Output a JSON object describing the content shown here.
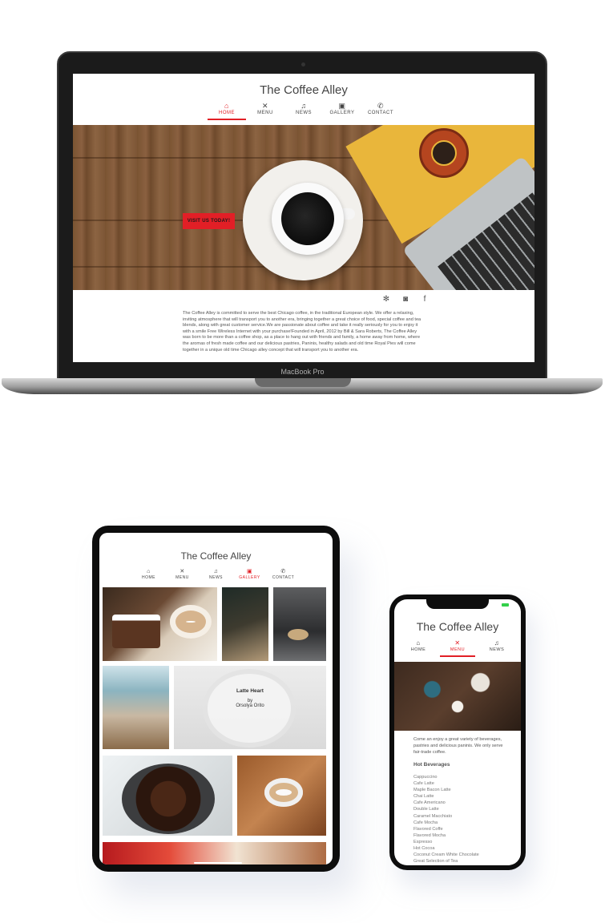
{
  "site": {
    "title": "The Coffee Alley"
  },
  "laptop": {
    "brand": "MacBook Pro",
    "nav": [
      {
        "label": "HOME",
        "icon": "home-icon",
        "active": true
      },
      {
        "label": "MENU",
        "icon": "utensils-icon",
        "active": false
      },
      {
        "label": "NEWS",
        "icon": "bell-icon",
        "active": false
      },
      {
        "label": "GALLERY",
        "icon": "gallery-icon",
        "active": false
      },
      {
        "label": "CONTACT",
        "icon": "phone-icon",
        "active": false
      }
    ],
    "cta": "VISIT US TODAY!",
    "social": [
      "yelp-icon",
      "instagram-icon",
      "facebook-icon"
    ],
    "about": "The Coffee Alley is committed to serve the best Chicago coffee, in the traditional European style.  We offer a relaxing, inviting atmosphere that will transport you to another era, bringing together a great choice of food, special coffee and tea blends, along with great customer service.We are passionate about coffee  and take it really seriously for you to enjoy it  with a smile Free Wireless Internet with your purchase!Founded in April, 2012 by Bill & Sara Roberts, The Coffee Alley was born to be more than a coffee shop,  as a place to hang out with friends and  family,  a home away from home,  where the aromas of fresh made coffee and our delicious pastries, Paninis,  healthy salads and old time Royal Pies will come together in a unique old time Chicago alley concept that will transport you to another era."
  },
  "tablet": {
    "nav": [
      {
        "label": "HOME",
        "icon": "home-icon",
        "active": false
      },
      {
        "label": "MENU",
        "icon": "utensils-icon",
        "active": false
      },
      {
        "label": "NEWS",
        "icon": "bell-icon",
        "active": false
      },
      {
        "label": "GALLERY",
        "icon": "gallery-icon",
        "active": true
      },
      {
        "label": "CONTACT",
        "icon": "phone-icon",
        "active": false
      }
    ],
    "caption": {
      "title": "Latte Heart",
      "by": "by",
      "author": "Orsolya Orito"
    }
  },
  "phone": {
    "nav": [
      {
        "label": "HOME",
        "icon": "home-icon",
        "active": false
      },
      {
        "label": "MENU",
        "icon": "utensils-icon",
        "active": true
      },
      {
        "label": "NEWS",
        "icon": "bell-icon",
        "active": false
      }
    ],
    "intro": "Come an enjoy a great variety of beverages, pastries and delicious paninis. We only serve fair-trade coffee.",
    "section_heading": "Hot Beverages",
    "items": [
      "Cappuccino",
      "Cafe Latte",
      "Maple Bacon Latte",
      "Chai Latte",
      "Cafe Americano",
      "Double Latte",
      "Caramel Macchiato",
      "Cafe Mocha",
      "Flavored Coffe",
      "Flavored Mocha",
      "Espresso",
      "Hot Cocoa",
      "Coconut Cream White Chocolate",
      "Great Selection of Tea"
    ]
  },
  "colors": {
    "accent": "#e21f26",
    "text": "#444444"
  }
}
